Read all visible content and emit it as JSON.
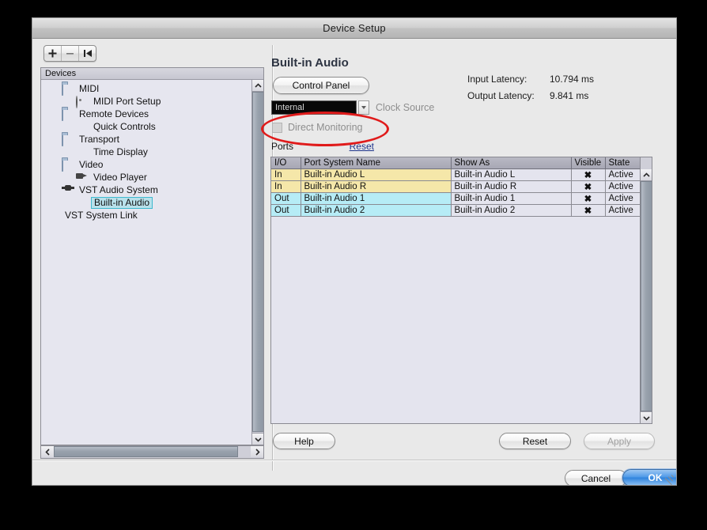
{
  "window": {
    "title": "Device Setup"
  },
  "sidebar": {
    "toolbar": [
      {
        "name": "add-device-button",
        "glyph": "+"
      },
      {
        "name": "remove-device-button",
        "glyph": "−"
      },
      {
        "name": "reset-device-button",
        "glyph": "reset"
      }
    ],
    "header": "Devices",
    "items": [
      {
        "label": "MIDI",
        "icon": "folder-icon",
        "indent": 1,
        "selected": false
      },
      {
        "label": "MIDI Port Setup",
        "icon": "disc-icon",
        "indent": 2,
        "selected": false
      },
      {
        "label": "Remote Devices",
        "icon": "folder-icon",
        "indent": 1,
        "selected": false
      },
      {
        "label": "Quick Controls",
        "icon": "none",
        "indent": 2,
        "selected": false
      },
      {
        "label": "Transport",
        "icon": "folder-icon",
        "indent": 1,
        "selected": false
      },
      {
        "label": "Time Display",
        "icon": "none",
        "indent": 2,
        "selected": false
      },
      {
        "label": "Video",
        "icon": "folder-icon",
        "indent": 1,
        "selected": false
      },
      {
        "label": "Video Player",
        "icon": "camera-icon",
        "indent": 2,
        "selected": false
      },
      {
        "label": "VST Audio System",
        "icon": "vst-icon",
        "indent": 1,
        "selected": false
      },
      {
        "label": "Built-in Audio",
        "icon": "none",
        "indent": 2,
        "selected": true
      },
      {
        "label": "VST System Link",
        "icon": "none",
        "indent": 0,
        "selected": false
      }
    ]
  },
  "main": {
    "title": "Built-in Audio",
    "control_panel_button": "Control Panel",
    "latency": {
      "input_label": "Input Latency:",
      "input_value": "10.794 ms",
      "output_label": "Output Latency:",
      "output_value": "9.841 ms"
    },
    "clock_source": {
      "value": "Internal",
      "label": "Clock Source"
    },
    "direct_monitoring": {
      "label": "Direct Monitoring",
      "checked": false
    },
    "ports_label": "Ports",
    "ports_reset_link": "Reset",
    "table": {
      "columns": [
        "I/O",
        "Port System Name",
        "Show As",
        "Visible",
        "State"
      ],
      "rows": [
        {
          "io": "In",
          "port_system_name": "Built-in Audio L",
          "show_as": "Built-in Audio L",
          "visible": "✖",
          "state": "Active",
          "kind": "in"
        },
        {
          "io": "In",
          "port_system_name": "Built-in Audio R",
          "show_as": "Built-in Audio R",
          "visible": "✖",
          "state": "Active",
          "kind": "in"
        },
        {
          "io": "Out",
          "port_system_name": "Built-in Audio 1",
          "show_as": "Built-in Audio 1",
          "visible": "✖",
          "state": "Active",
          "kind": "out"
        },
        {
          "io": "Out",
          "port_system_name": "Built-in Audio 2",
          "show_as": "Built-in Audio 2",
          "visible": "✖",
          "state": "Active",
          "kind": "out"
        }
      ]
    }
  },
  "buttons": {
    "help": "Help",
    "reset": "Reset",
    "apply": "Apply",
    "cancel": "Cancel",
    "ok": "OK"
  },
  "annotation": {
    "shape": "ellipse",
    "color": "#e01b1b",
    "target": "Direct Monitoring"
  }
}
